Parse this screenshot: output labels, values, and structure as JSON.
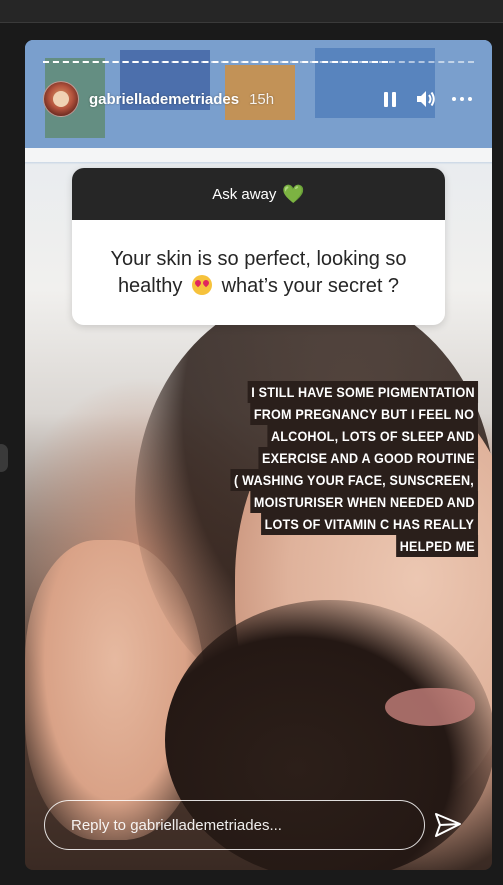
{
  "story": {
    "progress": 0.8,
    "user": {
      "username": "gabriellademetriades",
      "time_ago": "15h"
    },
    "controls": {
      "pause_icon": "pause-icon",
      "sound_icon": "speaker-icon",
      "more_icon": "more-options-icon"
    },
    "question": {
      "header": "Ask away",
      "header_emoji": "💚",
      "text_part1": "Your skin is so perfect, looking so healthy",
      "text_part2": "what’s your secret ?"
    },
    "caption_lines": [
      "I STILL HAVE SOME  PIGMENTATION",
      "FROM PREGNANCY BUT I FEEL NO",
      "ALCOHOL, LOTS OF SLEEP AND",
      "EXERCISE AND A GOOD ROUTINE",
      "( WASHING YOUR FACE, SUNSCREEN,",
      "MOISTURISER WHEN NEEDED AND",
      "LOTS OF VITAMIN C HAS REALLY",
      "HELPED ME"
    ],
    "reply": {
      "placeholder": "Reply to gabriellademetriades..."
    },
    "send_icon": "send-icon"
  },
  "colors": {
    "caption_bg": "#2a1f1b",
    "question_header_bg": "#262626"
  }
}
